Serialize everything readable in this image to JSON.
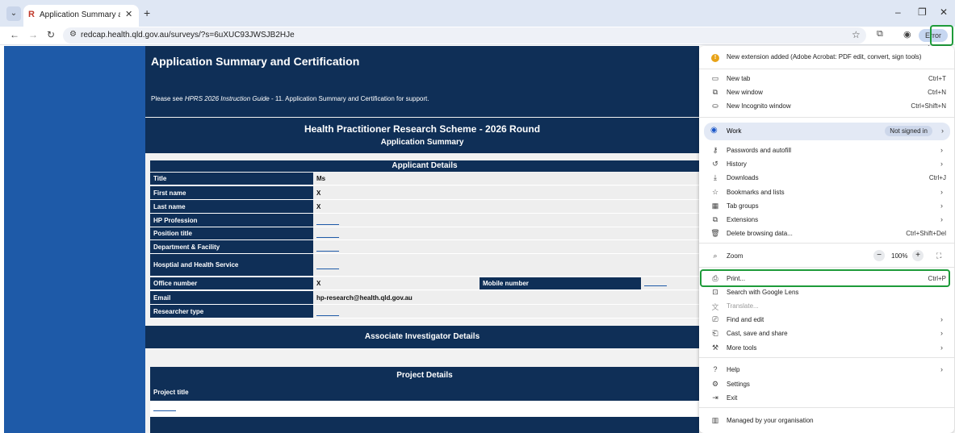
{
  "browser": {
    "tab_title": "Application Summary and Certifi",
    "tab_favicon": "R",
    "url": "redcap.health.qld.gov.au/surveys/?s=6uXUC93JWSJB2HJe",
    "profile_label": "Error",
    "new_tab_symbol": "+",
    "close_symbol": "✕"
  },
  "page": {
    "title": "Application Summary and Certification",
    "note_prefix": "Please see ",
    "note_italic": "HPRS 2026 Instruction Guide",
    "note_suffix": " - 11. Application Summary and Certification for support.",
    "scheme_title": "Health Practitioner Research Scheme - 2026 Round",
    "scheme_subtitle": "Application Summary",
    "applicant_heading": "Applicant Details",
    "rows": [
      {
        "label": "Title",
        "value": "Ms"
      },
      {
        "label": "First name",
        "value": "X"
      },
      {
        "label": "Last name",
        "value": "X"
      },
      {
        "label": "HP Profession",
        "value": ""
      },
      {
        "label": "Position title",
        "value": ""
      },
      {
        "label": "Department & Facility",
        "value": ""
      },
      {
        "label": "Hosptial and Health Service",
        "value": ""
      },
      {
        "label": "Office number",
        "value": "X"
      },
      {
        "label": "Email",
        "value": "hp-research@health.qld.gov.au"
      },
      {
        "label": "Researcher type",
        "value": ""
      }
    ],
    "mobile_label": "Mobile number",
    "associate_heading": "Associate Investigator Details",
    "project_heading": "Project Details",
    "project_title_label": "Project title"
  },
  "menu": {
    "notice": "New extension added (Adobe Acrobat: PDF edit, convert, sign tools)",
    "new_tab": {
      "label": "New tab",
      "shortcut": "Ctrl+T"
    },
    "new_window": {
      "label": "New window",
      "shortcut": "Ctrl+N"
    },
    "incognito": {
      "label": "New Incognito window",
      "shortcut": "Ctrl+Shift+N"
    },
    "work": {
      "label": "Work",
      "badge": "Not signed in"
    },
    "passwords": {
      "label": "Passwords and autofill"
    },
    "history": {
      "label": "History"
    },
    "downloads": {
      "label": "Downloads",
      "shortcut": "Ctrl+J"
    },
    "bookmarks": {
      "label": "Bookmarks and lists"
    },
    "tab_groups": {
      "label": "Tab groups"
    },
    "extensions": {
      "label": "Extensions"
    },
    "delete_data": {
      "label": "Delete browsing data...",
      "shortcut": "Ctrl+Shift+Del"
    },
    "zoom": {
      "label": "Zoom",
      "value": "100%",
      "minus": "−",
      "plus": "+"
    },
    "print": {
      "label": "Print...",
      "shortcut": "Ctrl+P"
    },
    "lens": {
      "label": "Search with Google Lens"
    },
    "translate": {
      "label": "Translate..."
    },
    "find_edit": {
      "label": "Find and edit"
    },
    "cast": {
      "label": "Cast, save and share"
    },
    "more_tools": {
      "label": "More tools"
    },
    "help": {
      "label": "Help"
    },
    "settings": {
      "label": "Settings"
    },
    "exit": {
      "label": "Exit"
    },
    "managed": {
      "label": "Managed by your organisation"
    }
  },
  "colors": {
    "page_navy": "#0f2f57",
    "sidebar_blue": "#1e5aa8",
    "highlight_green": "#1e9b3a"
  }
}
